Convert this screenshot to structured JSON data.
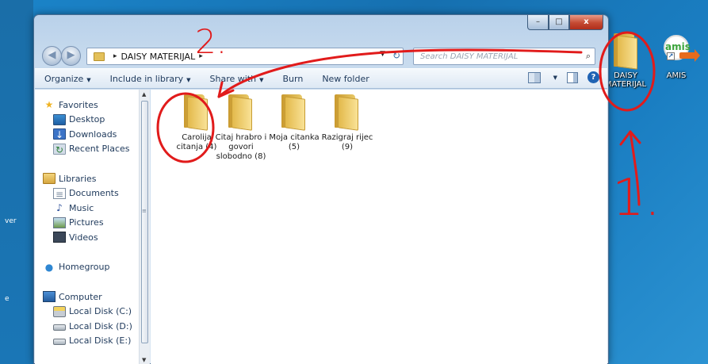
{
  "desktop": {
    "left_fragments": [
      "ver",
      "e"
    ],
    "icons": [
      {
        "label_line1": "DAISY",
        "label_line2": "MATERIJAL"
      },
      {
        "label_line1": "AMIS",
        "label_line2": "",
        "logo_text": "amis"
      }
    ]
  },
  "window": {
    "caption": {
      "minimize": "–",
      "maximize": "□",
      "close": "x"
    },
    "nav": {
      "back": "◀",
      "forward": "▶"
    },
    "address": {
      "path": [
        "DAISY MATERIJAL"
      ],
      "separator": "▸",
      "dropdown": "▼",
      "refresh": "↻"
    },
    "search": {
      "placeholder": "Search DAISY MATERIJAL",
      "icon": "⌕"
    },
    "toolbar": {
      "organize": "Organize",
      "include_in_library": "Include in library",
      "share_with": "Share with",
      "burn": "Burn",
      "new_folder": "New folder",
      "caret": "▼",
      "help": "?"
    },
    "nav_pane": {
      "favorites": "Favorites",
      "desktop": "Desktop",
      "downloads": "Downloads",
      "recent_places": "Recent Places",
      "libraries": "Libraries",
      "documents": "Documents",
      "music": "Music",
      "pictures": "Pictures",
      "videos": "Videos",
      "homegroup": "Homegroup",
      "computer": "Computer",
      "disk_c": "Local Disk (C:)",
      "disk_d": "Local Disk (D:)",
      "disk_e": "Local Disk (E:)"
    },
    "files": [
      {
        "name": "Carolija citanja (4)"
      },
      {
        "name": "Citaj hrabro i govori slobodno (8)"
      },
      {
        "name": "Moja citanka (5)"
      },
      {
        "name": "Razigraj rijec (9)"
      }
    ],
    "scroll": {
      "up": "▲",
      "down": "▼",
      "grip": "≡"
    }
  },
  "annotations": {
    "step1": "1.",
    "step2": "2."
  },
  "colors": {
    "annotation": "#e11b1b",
    "desktop": "#1a7ec2",
    "folder": "#e8c866"
  }
}
